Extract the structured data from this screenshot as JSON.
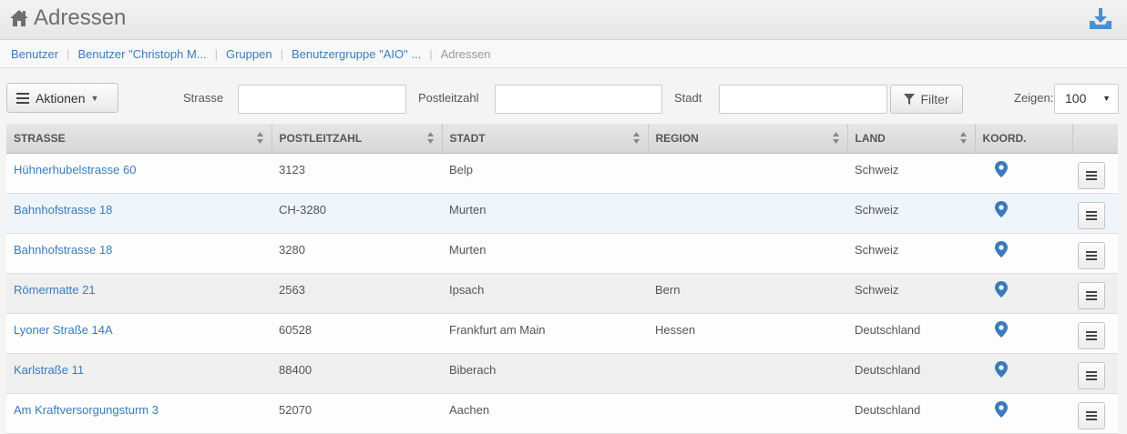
{
  "header": {
    "title": "Adressen",
    "home_icon": "home-icon",
    "download_icon": "download-tray-icon"
  },
  "breadcrumb": {
    "items": [
      "Benutzer",
      "Benutzer \"Christoph M...",
      "Gruppen",
      "Benutzergruppe \"AIO\" ..."
    ],
    "current": "Adressen"
  },
  "toolbar": {
    "actions_label": "Aktionen",
    "street_label": "Strasse",
    "street_value": "",
    "zip_label": "Postleitzahl",
    "zip_value": "",
    "city_label": "Stadt",
    "city_value": "",
    "filter_label": "Filter",
    "show_label": "Zeigen:",
    "show_value": "100"
  },
  "table": {
    "columns": [
      "STRASSE",
      "POSTLEITZAHL",
      "STADT",
      "REGION",
      "LAND",
      "KOORD."
    ],
    "rows": [
      [
        "Hühnerhubelstrasse 60",
        "3123",
        "Belp",
        "",
        "Schweiz"
      ],
      [
        "Bahnhofstrasse 18",
        "CH-3280",
        "Murten",
        "",
        "Schweiz"
      ],
      [
        "Bahnhofstrasse 18",
        "3280",
        "Murten",
        "",
        "Schweiz"
      ],
      [
        "Römermatte 21",
        "2563",
        "Ipsach",
        "Bern",
        "Schweiz"
      ],
      [
        "Lyoner Straße 14A",
        "60528",
        "Frankfurt am Main",
        "Hessen",
        "Deutschland"
      ],
      [
        "Karlstraße 11",
        "88400",
        "Biberach",
        "",
        "Deutschland"
      ],
      [
        "Am Kraftversorgungsturm 3",
        "52070",
        "Aachen",
        "",
        "Deutschland"
      ]
    ]
  },
  "colors": {
    "link": "#3a7bbd",
    "pin": "#3a7bbd"
  }
}
